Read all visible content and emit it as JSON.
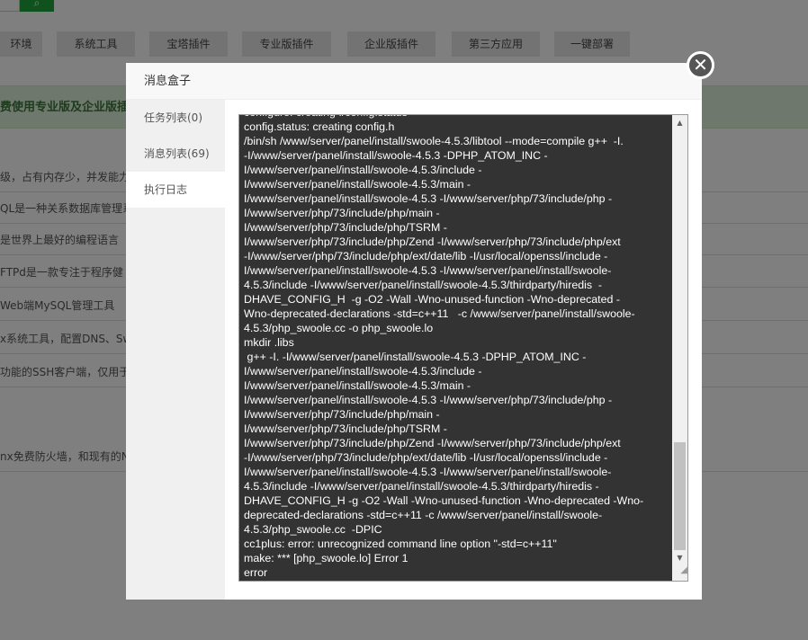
{
  "background": {
    "nav": [
      "环境",
      "系统工具",
      "宝塔插件",
      "专业版插件",
      "企业版插件",
      "第三方应用",
      "一键部署"
    ],
    "notice": "费使用专业版及企业版插",
    "rows": [
      "级，占有内存少，并发能力",
      "QL是一种关系数据库管理系",
      "是世界上最好的编程语言",
      "FTPd是一款专注于程序健",
      "Web端MySQL管理工具",
      "x系统工具，配置DNS、Sw",
      "功能的SSH客户端，仅用于",
      "nx免费防火墙，和现有的N"
    ]
  },
  "dialog": {
    "title": "消息盒子",
    "tabs": [
      {
        "label": "任务列表(0)"
      },
      {
        "label": "消息列表(69)"
      },
      {
        "label": "执行日志",
        "active": true
      }
    ],
    "close_icon": "close-icon",
    "log_scroll_fraction": 0.9,
    "log": "configure: creating ./config.status\nconfig.status: creating config.h\n/bin/sh /www/server/panel/install/swoole-4.5.3/libtool --mode=compile g++  -I.\n-I/www/server/panel/install/swoole-4.5.3 -DPHP_ATOM_INC -\nI/www/server/panel/install/swoole-4.5.3/include -\nI/www/server/panel/install/swoole-4.5.3/main -\nI/www/server/panel/install/swoole-4.5.3 -I/www/server/php/73/include/php -\nI/www/server/php/73/include/php/main -\nI/www/server/php/73/include/php/TSRM -\nI/www/server/php/73/include/php/Zend -I/www/server/php/73/include/php/ext\n-I/www/server/php/73/include/php/ext/date/lib -I/usr/local/openssl/include -\nI/www/server/panel/install/swoole-4.5.3 -I/www/server/panel/install/swoole-\n4.5.3/include -I/www/server/panel/install/swoole-4.5.3/thirdparty/hiredis  -\nDHAVE_CONFIG_H  -g -O2 -Wall -Wno-unused-function -Wno-deprecated -\nWno-deprecated-declarations -std=c++11   -c /www/server/panel/install/swoole-\n4.5.3/php_swoole.cc -o php_swoole.lo\nmkdir .libs\n g++ -I. -I/www/server/panel/install/swoole-4.5.3 -DPHP_ATOM_INC -\nI/www/server/panel/install/swoole-4.5.3/include -\nI/www/server/panel/install/swoole-4.5.3/main -\nI/www/server/panel/install/swoole-4.5.3 -I/www/server/php/73/include/php -\nI/www/server/php/73/include/php/main -\nI/www/server/php/73/include/php/TSRM -\nI/www/server/php/73/include/php/Zend -I/www/server/php/73/include/php/ext\n-I/www/server/php/73/include/php/ext/date/lib -I/usr/local/openssl/include -\nI/www/server/panel/install/swoole-4.5.3 -I/www/server/panel/install/swoole-\n4.5.3/include -I/www/server/panel/install/swoole-4.5.3/thirdparty/hiredis -\nDHAVE_CONFIG_H -g -O2 -Wall -Wno-unused-function -Wno-deprecated -Wno-\ndeprecated-declarations -std=c++11 -c /www/server/panel/install/swoole-\n4.5.3/php_swoole.cc  -DPIC\ncc1plus: error: unrecognized command line option \"-std=c++11\"\nmake: *** [php_swoole.lo] Error 1\nerror"
  }
}
